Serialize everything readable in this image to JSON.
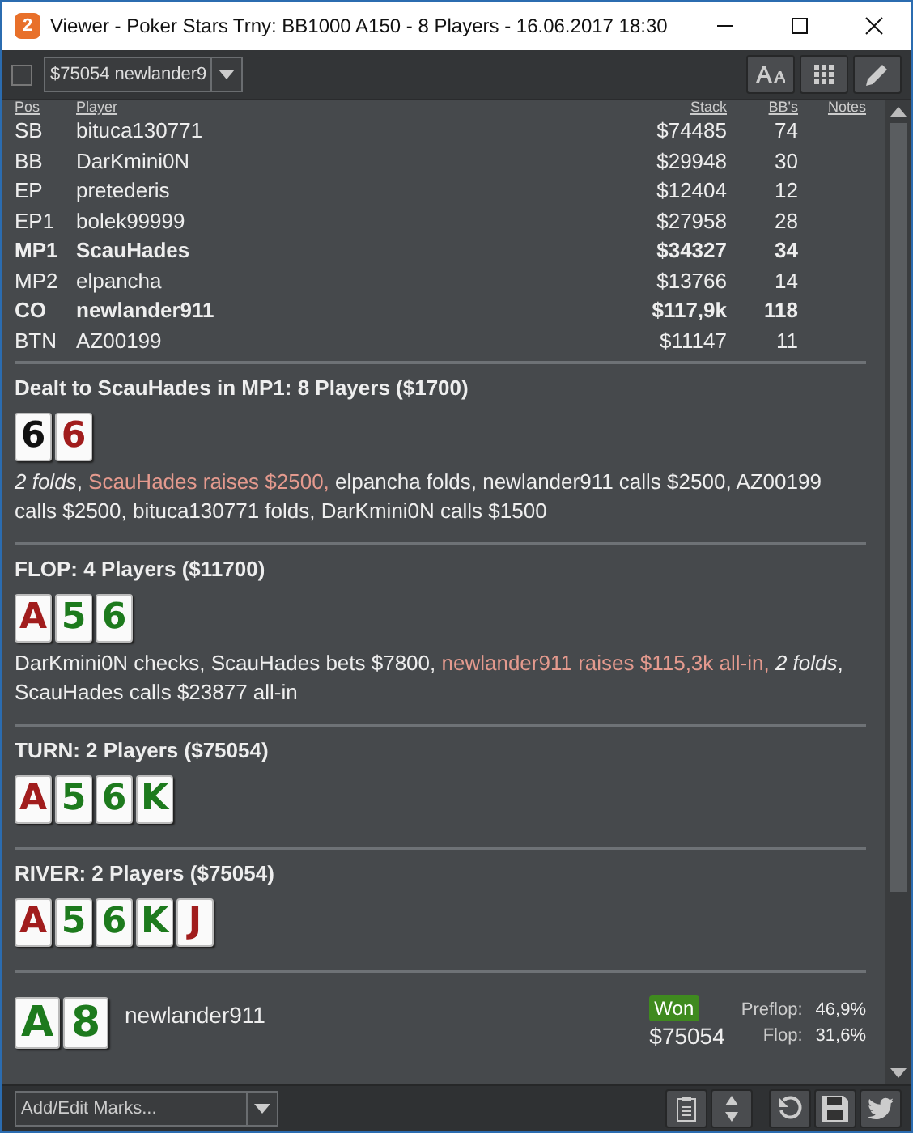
{
  "window": {
    "app_badge": "2",
    "title": "Viewer - Poker Stars Trny: BB1000 A150 - 8 Players - 16.06.2017 18:30"
  },
  "toolbar": {
    "checkbox": {
      "checked": false
    },
    "hand_selector": {
      "value": "$75054 newlander9"
    }
  },
  "table": {
    "columns": [
      "Pos",
      "Player",
      "Stack",
      "BB's",
      "Notes"
    ],
    "rows": [
      {
        "pos": "SB",
        "player": "bituca130771",
        "stack": "$74485",
        "bbs": "74",
        "highlighted": false
      },
      {
        "pos": "BB",
        "player": "DarKmini0N",
        "stack": "$29948",
        "bbs": "30",
        "highlighted": false
      },
      {
        "pos": "EP",
        "player": "pretederis",
        "stack": "$12404",
        "bbs": "12",
        "highlighted": false
      },
      {
        "pos": "EP1",
        "player": "bolek99999",
        "stack": "$27958",
        "bbs": "28",
        "highlighted": false
      },
      {
        "pos": "MP1",
        "player": "ScauHades",
        "stack": "$34327",
        "bbs": "34",
        "highlighted": true
      },
      {
        "pos": "MP2",
        "player": "elpancha",
        "stack": "$13766",
        "bbs": "14",
        "highlighted": false
      },
      {
        "pos": "CO",
        "player": "newlander911",
        "stack": "$117,9k",
        "bbs": "118",
        "highlighted": true
      },
      {
        "pos": "BTN",
        "player": "AZ00199",
        "stack": "$11147",
        "bbs": "11",
        "highlighted": false
      }
    ]
  },
  "streets": [
    {
      "heading": "Dealt to ScauHades in MP1: 8 Players ($1700)",
      "cards": [
        {
          "rank": "6",
          "color": "#111111"
        },
        {
          "rank": "6",
          "color": "#a11d1d"
        }
      ],
      "actions": [
        {
          "kind": "italic",
          "text": "2 folds"
        },
        {
          "kind": "plain",
          "text": ", "
        },
        {
          "kind": "highlight",
          "text": "ScauHades raises $2500,"
        },
        {
          "kind": "plain",
          "text": " elpancha folds, newlander911 calls $2500, AZ00199 calls $2500, bituca130771 folds, DarKmini0N calls $1500"
        }
      ]
    },
    {
      "heading": "FLOP: 4 Players ($11700)",
      "cards": [
        {
          "rank": "A",
          "color": "#a11d1d"
        },
        {
          "rank": "5",
          "color": "#1d7a1d"
        },
        {
          "rank": "6",
          "color": "#1d7a1d"
        }
      ],
      "actions": [
        {
          "kind": "plain",
          "text": "DarKmini0N checks, ScauHades bets $7800, "
        },
        {
          "kind": "highlight",
          "text": "newlander911 raises $115,3k all-in, "
        },
        {
          "kind": "italic",
          "text": "2 folds"
        },
        {
          "kind": "plain",
          "text": ", ScauHades calls $23877 all-in"
        }
      ]
    },
    {
      "heading": "TURN: 2 Players ($75054)",
      "cards": [
        {
          "rank": "A",
          "color": "#a11d1d"
        },
        {
          "rank": "5",
          "color": "#1d7a1d"
        },
        {
          "rank": "6",
          "color": "#1d7a1d"
        },
        {
          "rank": "K",
          "color": "#1d7a1d"
        }
      ]
    },
    {
      "heading": "RIVER: 2 Players ($75054)",
      "cards": [
        {
          "rank": "A",
          "color": "#a11d1d"
        },
        {
          "rank": "5",
          "color": "#1d7a1d"
        },
        {
          "rank": "6",
          "color": "#1d7a1d"
        },
        {
          "rank": "K",
          "color": "#1d7a1d"
        },
        {
          "rank": "J",
          "color": "#a11d1d"
        }
      ]
    }
  ],
  "result": {
    "cards": [
      {
        "rank": "A",
        "color": "#1d7a1d"
      },
      {
        "rank": "8",
        "color": "#1d7a1d"
      }
    ],
    "player": "newlander911",
    "badge": "Won",
    "amount": "$75054",
    "equity": [
      {
        "label": "Preflop:",
        "value": "46,9%"
      },
      {
        "label": "Flop:",
        "value": "31,6%"
      }
    ]
  },
  "bottom_bar": {
    "marks_selector": {
      "placeholder": "Add/Edit Marks..."
    }
  }
}
